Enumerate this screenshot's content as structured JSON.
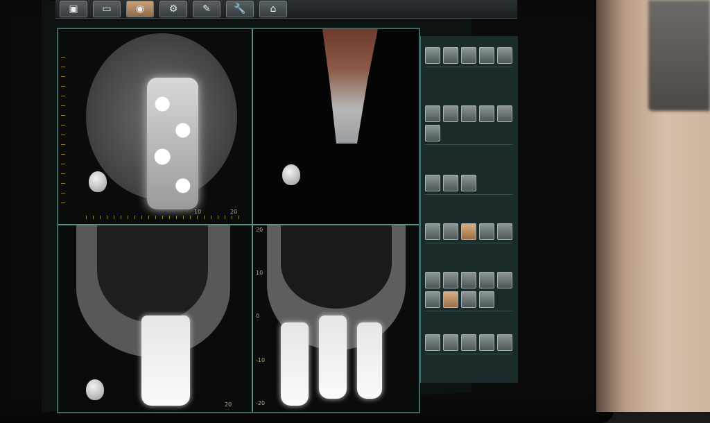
{
  "app": {
    "window_title": "",
    "view_tab": ""
  },
  "toolbar": {
    "tools": [
      {
        "icon": "image-icon",
        "active": false
      },
      {
        "icon": "open-icon",
        "active": false
      },
      {
        "icon": "dental-icon",
        "active": true
      },
      {
        "icon": "tools-icon",
        "active": false
      },
      {
        "icon": "edit-icon",
        "active": false
      },
      {
        "icon": "wrench-icon",
        "active": false
      },
      {
        "icon": "home-icon",
        "active": false
      }
    ]
  },
  "views": {
    "axial": {
      "ticks_bottom": [
        "10",
        "20"
      ]
    },
    "coronal": {
      "ticks_bottom": [
        "20"
      ]
    },
    "sagittal": {
      "ticks_left": [
        "20",
        "10",
        "0",
        "-10",
        "-20"
      ]
    }
  },
  "panel": {
    "sections": [
      {
        "title": "",
        "buttons": 5,
        "active_index": -1
      },
      {
        "title": "",
        "buttons": 6,
        "active_index": -1
      },
      {
        "title": "",
        "buttons": 3,
        "active_index": -1
      },
      {
        "title": "",
        "buttons": 5,
        "active_index": 2
      },
      {
        "title": "",
        "buttons": 9,
        "active_index": 6
      },
      {
        "title": "",
        "buttons": 5,
        "active_index": -1
      }
    ]
  },
  "colors": {
    "accent": "#3c6b66",
    "active_button": "#c8a07a",
    "ruler": "#b3a52c"
  }
}
